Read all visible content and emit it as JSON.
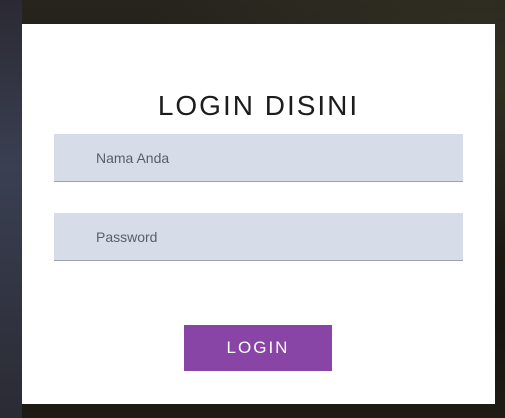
{
  "login": {
    "title": "LOGIN DISINI",
    "name_field": {
      "placeholder": "Nama Anda",
      "value": ""
    },
    "password_field": {
      "placeholder": "Password",
      "value": ""
    },
    "submit_label": "LOGIN"
  },
  "colors": {
    "card_background": "#ffffff",
    "field_background": "#d6dde9",
    "button_background": "#8845a6",
    "button_text": "#ffffff",
    "title_text": "#1c1c1c"
  }
}
